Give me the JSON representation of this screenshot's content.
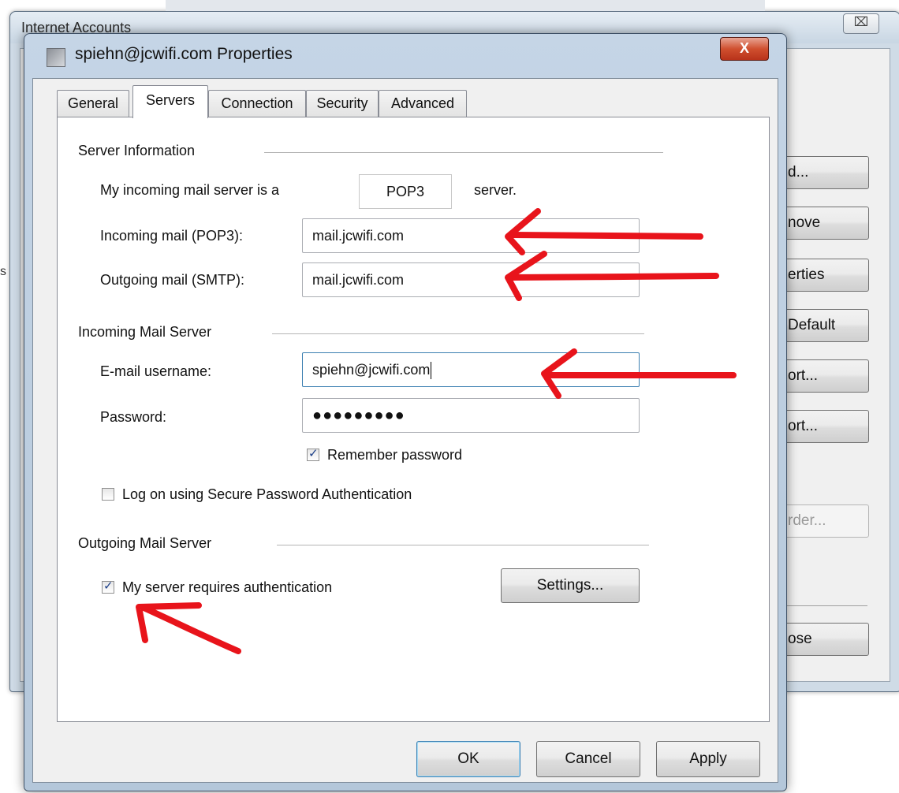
{
  "background_window": {
    "title": "Internet Accounts",
    "close_label": "⌧",
    "side_text": "s",
    "buttons": [
      {
        "label": "Add...",
        "visible": "d..."
      },
      {
        "label": "Remove",
        "visible": "nove"
      },
      {
        "label": "Properties",
        "visible": "erties"
      },
      {
        "label": "Set as Default",
        "visible": "Default"
      },
      {
        "label": "Import...",
        "visible": "ort..."
      },
      {
        "label": "Export...",
        "visible": "ort..."
      },
      {
        "label": "Set Order...",
        "visible": "rder..."
      },
      {
        "label": "Close",
        "visible": "ose"
      }
    ]
  },
  "dialog": {
    "title": "spiehn@jcwifi.com Properties",
    "close_label": "X",
    "tabs": [
      {
        "label": "General",
        "active": false
      },
      {
        "label": "Servers",
        "active": true
      },
      {
        "label": "Connection",
        "active": false
      },
      {
        "label": "Security",
        "active": false
      },
      {
        "label": "Advanced",
        "active": false
      }
    ],
    "server_info": {
      "heading": "Server Information",
      "incoming_type_prefix": "My incoming mail server is a",
      "incoming_type": "POP3",
      "incoming_type_suffix": "server.",
      "incoming_label": "Incoming mail (POP3):",
      "incoming_value": "mail.jcwifi.com",
      "outgoing_label": "Outgoing mail (SMTP):",
      "outgoing_value": "mail.jcwifi.com"
    },
    "incoming_server": {
      "heading": "Incoming Mail Server",
      "username_label": "E-mail username:",
      "username_value": "spiehn@jcwifi.com",
      "password_label": "Password:",
      "password_value": "●●●●●●●●●",
      "remember_label": "Remember password",
      "remember_checked": true,
      "spa_label": "Log on using Secure Password Authentication",
      "spa_checked": false
    },
    "outgoing_server": {
      "heading": "Outgoing Mail Server",
      "auth_label": "My server requires authentication",
      "auth_checked": true,
      "settings_label": "Settings..."
    },
    "footer": {
      "ok_label": "OK",
      "cancel_label": "Cancel",
      "apply_label": "Apply"
    }
  },
  "annotations": {
    "arrow_color": "#e8141b"
  }
}
